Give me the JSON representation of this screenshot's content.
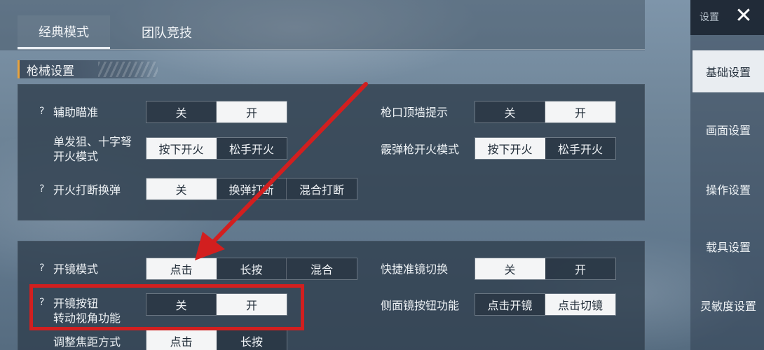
{
  "tabs": [
    {
      "label": "经典模式",
      "active": true
    },
    {
      "label": "团队竞技",
      "active": false
    }
  ],
  "section": {
    "title": "枪械设置"
  },
  "panel1": {
    "left": [
      {
        "help": "?",
        "label": "辅助瞄准",
        "options": [
          "关",
          "开"
        ],
        "selected": 1
      },
      {
        "help": "",
        "label": "单发狙、十字弩\n开火模式",
        "options": [
          "按下开火",
          "松手开火"
        ],
        "selected": 0
      },
      {
        "help": "?",
        "label": "开火打断换弹",
        "options": [
          "关",
          "换弹打断",
          "混合打断"
        ],
        "selected": 0
      }
    ],
    "right": [
      {
        "label": "枪口顶墙提示",
        "options": [
          "关",
          "开"
        ],
        "selected": 1
      },
      {
        "label": "霰弹枪开火模式",
        "options": [
          "按下开火",
          "松手开火"
        ],
        "selected": 0
      }
    ]
  },
  "panel2": {
    "left": [
      {
        "help": "?",
        "label": "开镜模式",
        "options": [
          "点击",
          "长按",
          "混合"
        ],
        "selected": 0
      },
      {
        "help": "?",
        "label": "开镜按钮\n转动视角功能",
        "options": [
          "关",
          "开"
        ],
        "selected": 1
      },
      {
        "help": "",
        "label": "调整焦距方式",
        "options": [
          "点击",
          "长按"
        ],
        "selected": 0
      }
    ],
    "right": [
      {
        "label": "快捷准镜切换",
        "options": [
          "关",
          "开"
        ],
        "selected": 0
      },
      {
        "label": "侧面镜按钮功能",
        "options": [
          "点击开镜",
          "点击切镜"
        ],
        "selected": 1
      }
    ]
  },
  "sidebar": {
    "title": "设置",
    "close_icon": "close-icon",
    "items": [
      {
        "label": "基础设置",
        "active": true
      },
      {
        "label": "画面设置",
        "active": false
      },
      {
        "label": "操作设置",
        "active": false
      },
      {
        "label": "载具设置",
        "active": false
      },
      {
        "label": "灵敏度设置",
        "active": false
      }
    ]
  },
  "annotation": {
    "color": "#d21f1f"
  }
}
